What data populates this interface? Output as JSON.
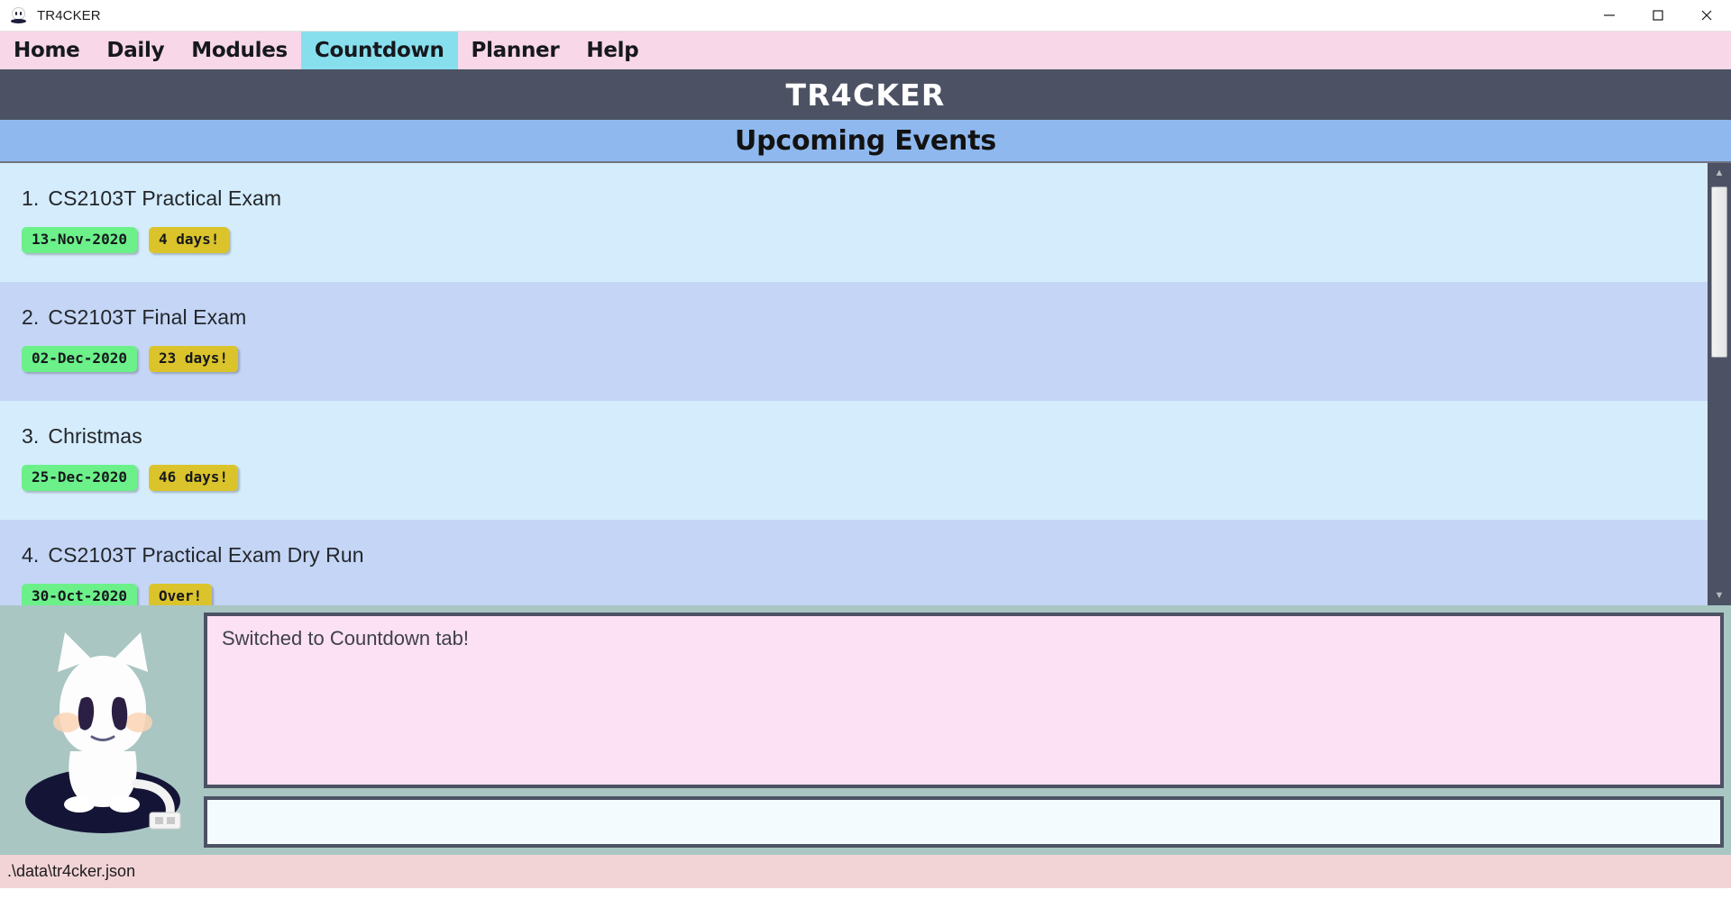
{
  "window": {
    "title": "TR4CKER",
    "icon": "cat-app-icon",
    "controls": [
      {
        "name": "minimize-button",
        "glyph": "minimize-icon"
      },
      {
        "name": "maximize-button",
        "glyph": "maximize-icon"
      },
      {
        "name": "close-button",
        "glyph": "close-icon"
      }
    ]
  },
  "menu": {
    "items": [
      {
        "label": "Home",
        "active": false
      },
      {
        "label": "Daily",
        "active": false
      },
      {
        "label": "Modules",
        "active": false
      },
      {
        "label": "Countdown",
        "active": true
      },
      {
        "label": "Planner",
        "active": false
      },
      {
        "label": "Help",
        "active": false
      }
    ]
  },
  "header": {
    "title": "TR4CKER"
  },
  "section": {
    "title": "Upcoming Events"
  },
  "events": [
    {
      "num": "1.",
      "title": "CS2103T Practical Exam",
      "date": "13-Nov-2020",
      "countdown": "4 days!"
    },
    {
      "num": "2.",
      "title": "CS2103T Final Exam",
      "date": "02-Dec-2020",
      "countdown": "23 days!"
    },
    {
      "num": "3.",
      "title": "Christmas",
      "date": "25-Dec-2020",
      "countdown": "46 days!"
    },
    {
      "num": "4.",
      "title": "CS2103T Practical Exam Dry Run",
      "date": "30-Oct-2020",
      "countdown": "Over!"
    }
  ],
  "console": {
    "output": "Switched to Countdown tab!",
    "input_value": "",
    "input_placeholder": ""
  },
  "statusbar": {
    "path": ".\\data\\tr4cker.json"
  },
  "colors": {
    "menu_bg": "#f7d7e8",
    "menu_active": "#87dfee",
    "header_bg": "#4c5263",
    "section_bg": "#8fb8ee",
    "row_odd": "#d4ecfb",
    "row_even": "#c4d5f5",
    "badge_date": "#6cf08a",
    "badge_count": "#dbc42b",
    "bottom_bg": "#a9c6c3",
    "output_bg": "#fce0f4",
    "input_bg": "#f4fbfe",
    "statusbar_bg": "#f2d3d6"
  }
}
